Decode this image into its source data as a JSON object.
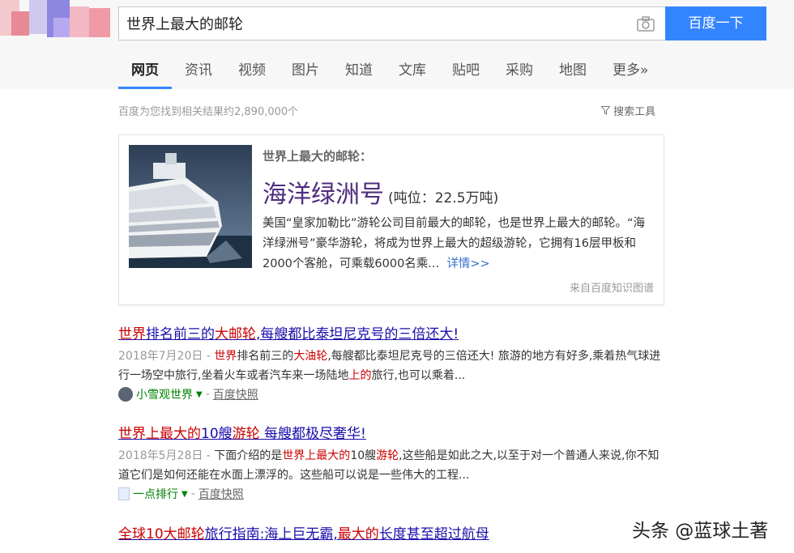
{
  "search": {
    "query": "世界上最大的邮轮",
    "button_label": "百度一下"
  },
  "tabs": [
    {
      "label": "网页",
      "active": true
    },
    {
      "label": "资讯"
    },
    {
      "label": "视频"
    },
    {
      "label": "图片"
    },
    {
      "label": "知道"
    },
    {
      "label": "文库"
    },
    {
      "label": "贴吧"
    },
    {
      "label": "采购"
    },
    {
      "label": "地图"
    },
    {
      "label": "更多»"
    }
  ],
  "result_count": "百度为您找到相关结果约2,890,000个",
  "search_tools": "搜索工具",
  "card": {
    "question": "世界上最大的邮轮：",
    "answer": "海洋绿洲号",
    "answer_sub": "(吨位：22.5万吨)",
    "description": "美国“皇家加勒比”游轮公司目前最大的邮轮，也是世界上最大的邮轮。“海洋绿洲号”豪华游轮，将成为世界上最大的超级游轮，它拥有16层甲板和2000个客舱，可乘载6000名乘...",
    "more": "详情>>",
    "source": "来自百度知识图谱"
  },
  "results": [
    {
      "title_parts": [
        "世界",
        "排名前三的",
        "大邮轮",
        ",每艘都比泰坦尼克号的三倍还大!"
      ],
      "date": "2018年7月20日 - ",
      "abstract_parts": [
        "世界",
        "排名前三的",
        "大油轮",
        ",每艘都比泰坦尼克号的三倍还大! 旅游的地方有好多,乘着热气球进行一场空中旅行,坐着火车或者汽车来一场陆地",
        "上的",
        "旅行,也可以乘着..."
      ],
      "source_name": "小雪观世界",
      "snapshot": "百度快照"
    },
    {
      "title_parts": [
        "世界上最大的",
        "10艘",
        "游轮",
        " 每艘都极尽奢华!"
      ],
      "date": "2018年5月28日 - ",
      "abstract_parts": [
        "下面介绍的是",
        "世界上最大的",
        "10艘",
        "游轮",
        ",这些船是如此之大,以至于对一个普通人来说,你不知道它们是如何还能在水面上漂浮的。这些船可以说是一些伟大的工程..."
      ],
      "source_name": "一点排行",
      "snapshot": "百度快照"
    },
    {
      "title_parts": [
        "全球10大",
        "邮轮",
        "旅行指南:海上巨无霸,",
        "最大的",
        "长度甚至超过航母"
      ]
    }
  ],
  "watermark": "头条 @蓝球土著"
}
